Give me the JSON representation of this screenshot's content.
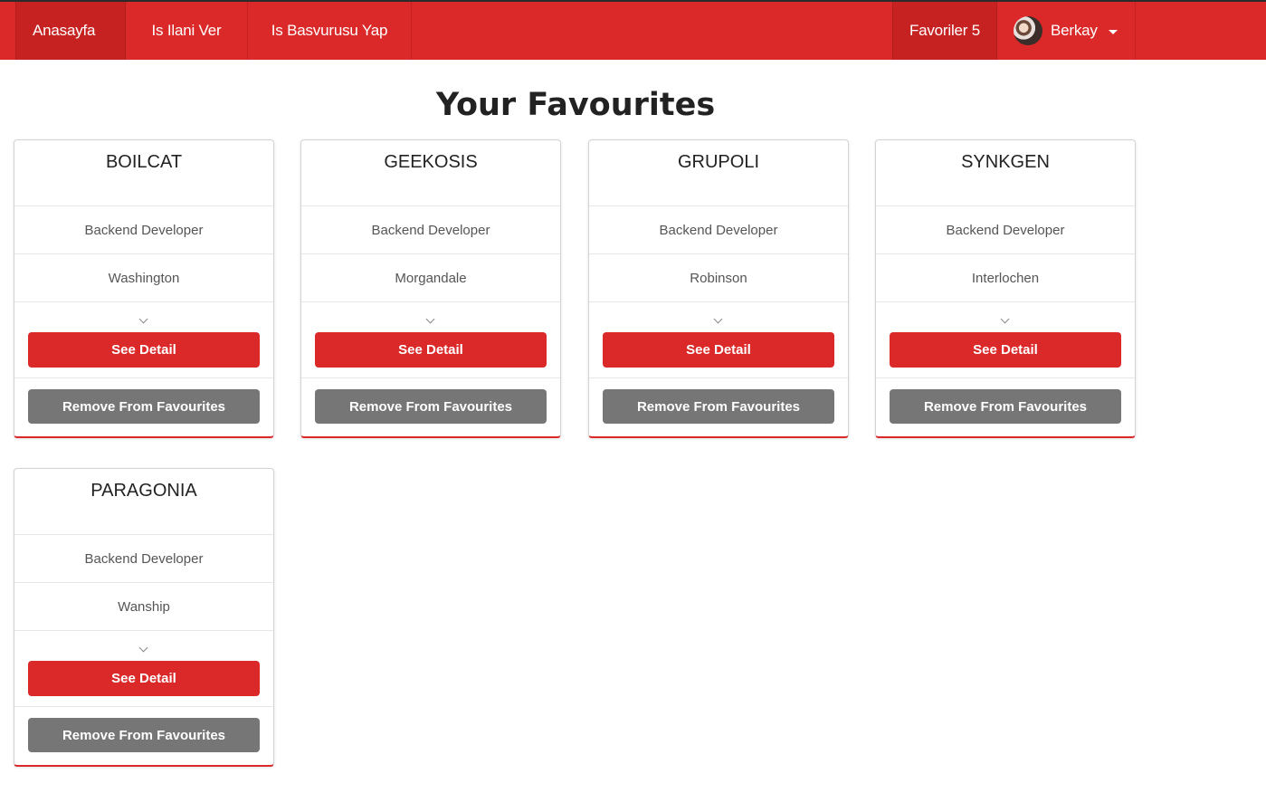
{
  "navbar": {
    "home": "Anasayfa",
    "post_job": "Is Ilani Ver",
    "apply_job": "Is Basvurusu Yap",
    "favourites": "Favoriler 5",
    "user_name": "Berkay"
  },
  "page": {
    "title": "Your Favourites"
  },
  "buttons": {
    "see_detail": "See Detail",
    "remove": "Remove From Favourites"
  },
  "cards": [
    {
      "company": "BOILCAT",
      "position": "Backend Developer",
      "city": "Washington"
    },
    {
      "company": "GEEKOSIS",
      "position": "Backend Developer",
      "city": "Morgandale"
    },
    {
      "company": "GRUPOLI",
      "position": "Backend Developer",
      "city": "Robinson"
    },
    {
      "company": "SYNKGEN",
      "position": "Backend Developer",
      "city": "Interlochen"
    },
    {
      "company": "PARAGONIA",
      "position": "Backend Developer",
      "city": "Wanship"
    }
  ],
  "colors": {
    "primary": "#db2828",
    "secondary": "#767676"
  }
}
